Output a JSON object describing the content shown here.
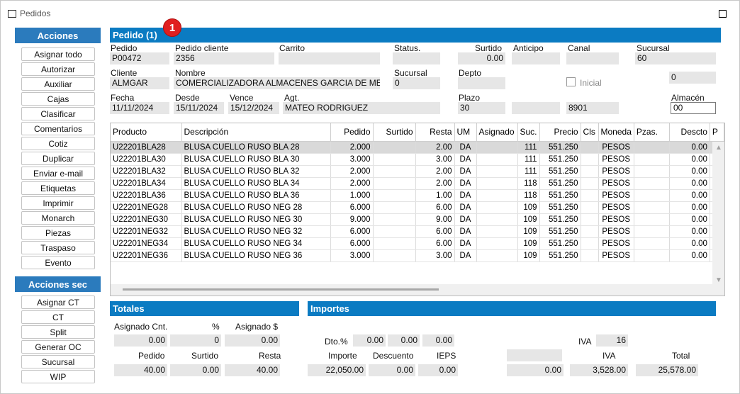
{
  "window": {
    "title": "Pedidos"
  },
  "badge": "1",
  "sidebar": {
    "acciones_title": "Acciones",
    "acciones": [
      "Asignar todo",
      "Autorizar",
      "Auxiliar",
      "Cajas",
      "Clasificar",
      "Comentarios",
      "Cotiz",
      "Duplicar",
      "Enviar e-mail",
      "Etiquetas",
      "Imprimir",
      "Monarch",
      "Piezas",
      "Traspaso",
      "Evento"
    ],
    "acciones_sec_title": "Acciones sec",
    "acciones_sec": [
      "Asignar CT",
      "CT",
      "Split",
      "Generar OC",
      "Sucursal",
      "WIP"
    ]
  },
  "pedido": {
    "title": "Pedido (1)",
    "labels": {
      "pedido": "Pedido",
      "pedido_cliente": "Pedido cliente",
      "carrito": "Carrito",
      "status": "Status.",
      "surtido": "Surtido",
      "anticipo": "Anticipo",
      "canal": "Canal",
      "sucursal": "Sucursal",
      "cliente": "Cliente",
      "nombre": "Nombre",
      "sucursal2": "Sucursal",
      "depto": "Depto",
      "inicial": "Inicial",
      "fecha": "Fecha",
      "desde": "Desde",
      "vence": "Vence",
      "agt": "Agt.",
      "plazo": "Plazo",
      "almacen": "Almacén"
    },
    "values": {
      "pedido": "P00472",
      "pedido_cliente": "2356",
      "carrito": "",
      "status": "",
      "surtido": "0.00",
      "anticipo": "",
      "canal": "",
      "sucursal": "60",
      "cliente": "ALMGAR",
      "nombre": "COMERCIALIZADORA ALMACENES GARCIA DE MEXIC",
      "sucursal2": "0",
      "depto": "",
      "inicial_value": "0",
      "fecha": "11/11/2024",
      "desde": "15/11/2024",
      "vence": "15/12/2024",
      "agt": "MATEO RODRIGUEZ",
      "plazo": "30",
      "plazo_extra": "",
      "code": "8901",
      "almacen": "00"
    }
  },
  "grid": {
    "columns": [
      "Producto",
      "Descripción",
      "Pedido",
      "Surtido",
      "Resta",
      "UM",
      "Asignado",
      "Suc.",
      "Precio",
      "Cls",
      "Moneda",
      "Pzas.",
      "Descto",
      "P"
    ],
    "rows": [
      [
        "U22201BLA28",
        "BLUSA CUELLO RUSO BLA 28",
        "2.000",
        "",
        "2.00",
        "DA",
        "",
        "111",
        "551.250",
        "",
        "PESOS",
        "",
        "0.00"
      ],
      [
        "U22201BLA30",
        "BLUSA CUELLO RUSO BLA 30",
        "3.000",
        "",
        "3.00",
        "DA",
        "",
        "111",
        "551.250",
        "",
        "PESOS",
        "",
        "0.00"
      ],
      [
        "U22201BLA32",
        "BLUSA CUELLO RUSO BLA 32",
        "2.000",
        "",
        "2.00",
        "DA",
        "",
        "111",
        "551.250",
        "",
        "PESOS",
        "",
        "0.00"
      ],
      [
        "U22201BLA34",
        "BLUSA CUELLO RUSO BLA 34",
        "2.000",
        "",
        "2.00",
        "DA",
        "",
        "118",
        "551.250",
        "",
        "PESOS",
        "",
        "0.00"
      ],
      [
        "U22201BLA36",
        "BLUSA CUELLO RUSO BLA 36",
        "1.000",
        "",
        "1.00",
        "DA",
        "",
        "118",
        "551.250",
        "",
        "PESOS",
        "",
        "0.00"
      ],
      [
        "U22201NEG28",
        "BLUSA CUELLO RUSO NEG 28",
        "6.000",
        "",
        "6.00",
        "DA",
        "",
        "109",
        "551.250",
        "",
        "PESOS",
        "",
        "0.00"
      ],
      [
        "U22201NEG30",
        "BLUSA CUELLO RUSO NEG 30",
        "9.000",
        "",
        "9.00",
        "DA",
        "",
        "109",
        "551.250",
        "",
        "PESOS",
        "",
        "0.00"
      ],
      [
        "U22201NEG32",
        "BLUSA CUELLO RUSO NEG 32",
        "6.000",
        "",
        "6.00",
        "DA",
        "",
        "109",
        "551.250",
        "",
        "PESOS",
        "",
        "0.00"
      ],
      [
        "U22201NEG34",
        "BLUSA CUELLO RUSO NEG 34",
        "6.000",
        "",
        "6.00",
        "DA",
        "",
        "109",
        "551.250",
        "",
        "PESOS",
        "",
        "0.00"
      ],
      [
        "U22201NEG36",
        "BLUSA CUELLO RUSO NEG 36",
        "3.000",
        "",
        "3.00",
        "DA",
        "",
        "109",
        "551.250",
        "",
        "PESOS",
        "",
        "0.00"
      ]
    ]
  },
  "totales": {
    "title": "Totales",
    "asignado_cnt_label": "Asignado Cnt.",
    "pct_label": "%",
    "asignado_money_label": "Asignado $",
    "asignado_cnt": "0.00",
    "pct": "0",
    "asignado_money": "0.00",
    "pedido_label": "Pedido",
    "surtido_label": "Surtido",
    "resta_label": "Resta",
    "pedido": "40.00",
    "surtido": "0.00",
    "resta": "40.00"
  },
  "importes": {
    "title": "Importes",
    "dto_label": "Dto.%",
    "dto1": "0.00",
    "dto2": "0.00",
    "dto3": "0.00",
    "iva_rate_label": "IVA",
    "iva_rate": "16",
    "importe_label": "Importe",
    "descuento_label": "Descuento",
    "ieps_label": "IEPS",
    "iva_label": "IVA",
    "total_label": "Total",
    "importe": "22,050.00",
    "descuento": "0.00",
    "ieps": "0.00",
    "blank": "",
    "extra": "0.00",
    "iva": "3,528.00",
    "total": "25,578.00"
  }
}
